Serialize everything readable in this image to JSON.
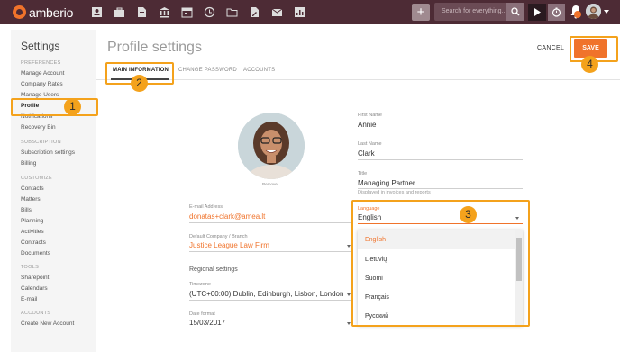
{
  "app": {
    "name": "amberio",
    "colors": {
      "topbar": "#4d2b35",
      "accent": "#f0732b",
      "highlight": "#f4a21c"
    }
  },
  "topbar": {
    "nav_icons": [
      "contacts-icon",
      "briefcase-icon",
      "document-icon",
      "bank-icon",
      "calendar-icon",
      "history-icon",
      "folder-icon",
      "file-edit-icon",
      "mail-icon",
      "report-icon"
    ],
    "search_placeholder": "Search for everything..."
  },
  "sidebar": {
    "title": "Settings",
    "sections": [
      {
        "label": "PREFERENCES",
        "items": [
          "Manage Account",
          "Company Rates",
          "Manage Users",
          "Profile",
          "Notifications",
          "Recovery Bin"
        ]
      },
      {
        "label": "SUBSCRIPTION",
        "items": [
          "Subscription settings",
          "Billing"
        ]
      },
      {
        "label": "CUSTOMIZE",
        "items": [
          "Contacts",
          "Matters",
          "Bills",
          "Planning",
          "Activities",
          "Contracts",
          "Documents"
        ]
      },
      {
        "label": "TOOLS",
        "items": [
          "Sharepoint",
          "Calendars",
          "E-mail"
        ]
      },
      {
        "label": "ACCOUNTS",
        "items": [
          "Create New Account"
        ]
      }
    ],
    "active_item": "Profile"
  },
  "main": {
    "title": "Profile settings",
    "cancel_label": "CANCEL",
    "save_label": "SAVE",
    "tabs": [
      "MAIN INFORMATION",
      "CHANGE PASSWORD",
      "ACCOUNTS"
    ],
    "active_tab": "MAIN INFORMATION",
    "remove_label": "Remove",
    "fields": {
      "first_name": {
        "label": "First Name",
        "value": "Annie"
      },
      "last_name": {
        "label": "Last Name",
        "value": "Clark"
      },
      "title": {
        "label": "Title",
        "value": "Managing Partner",
        "helper": "Displayed in invoices and reports"
      },
      "email": {
        "label": "E-mail Address",
        "value": "donatas+clark@amea.lt"
      },
      "company": {
        "label": "Default Company / Branch",
        "value": "Justice League Law Firm"
      },
      "regional_heading": "Regional settings",
      "timezone": {
        "label": "Timezone",
        "value": "(UTC+00:00) Dublin, Edinburgh, Lisbon, London"
      },
      "date_format": {
        "label": "Date format",
        "value": "15/03/2017"
      },
      "language": {
        "label": "Language",
        "value": "English"
      }
    },
    "language_options": [
      "English",
      "Lietuvių",
      "Suomi",
      "Français",
      "Русский"
    ],
    "selected_language": "English"
  },
  "callouts": [
    "1",
    "2",
    "3",
    "4"
  ]
}
